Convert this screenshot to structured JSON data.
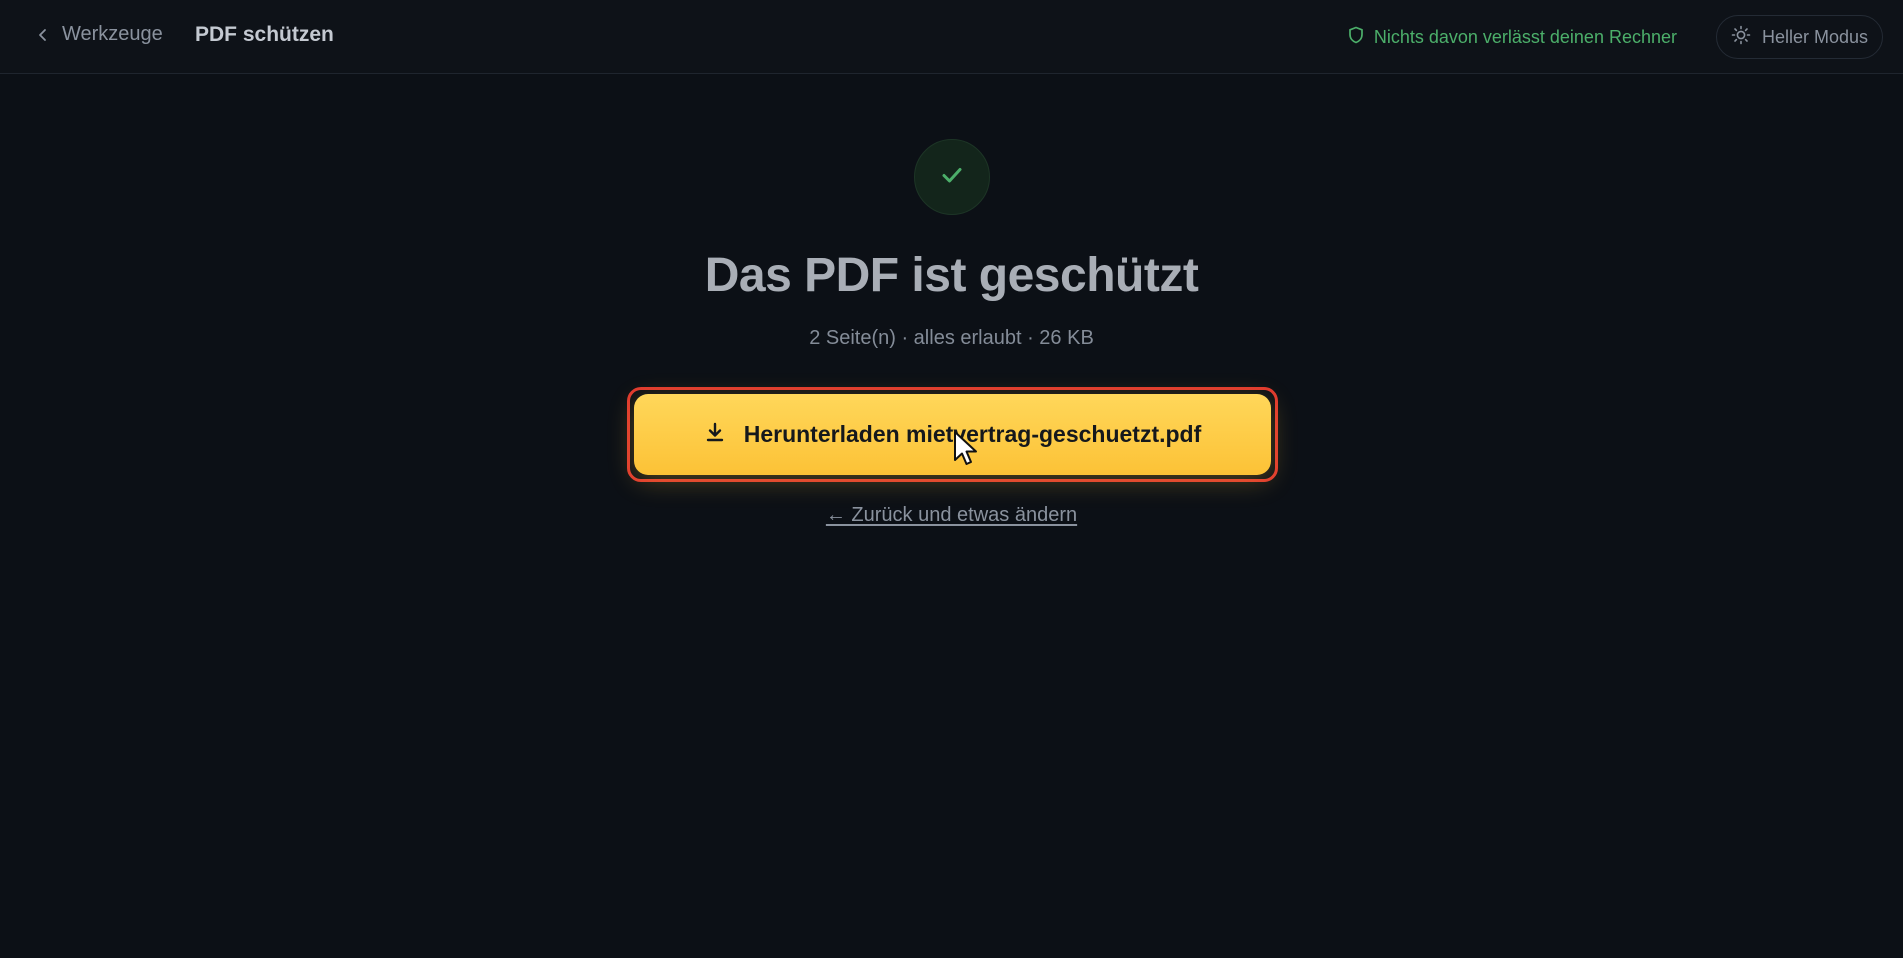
{
  "header": {
    "back_label": "Werkzeuge",
    "title": "PDF schützen",
    "privacy_text": "Nichts davon verlässt deinen Rechner",
    "theme_toggle_label": "Heller Modus"
  },
  "main": {
    "heading": "Das PDF ist geschützt",
    "file_info": "2 Seite(n) · alles erlaubt · 26 KB",
    "download_label": "Herunterladen mietvertrag-geschuetzt.pdf",
    "back_change_label": "← Zurück und etwas ändern"
  },
  "icons": {
    "back": "chevron-left-icon",
    "privacy": "shield-icon",
    "theme": "sun-icon",
    "success": "check-icon",
    "download": "download-icon",
    "cursor": "mouse-pointer-icon"
  },
  "colors": {
    "background": "#0c1016",
    "accent_yellow": "#fcc236",
    "success_green": "#4caf6a",
    "highlight_red": "#e0392f"
  }
}
